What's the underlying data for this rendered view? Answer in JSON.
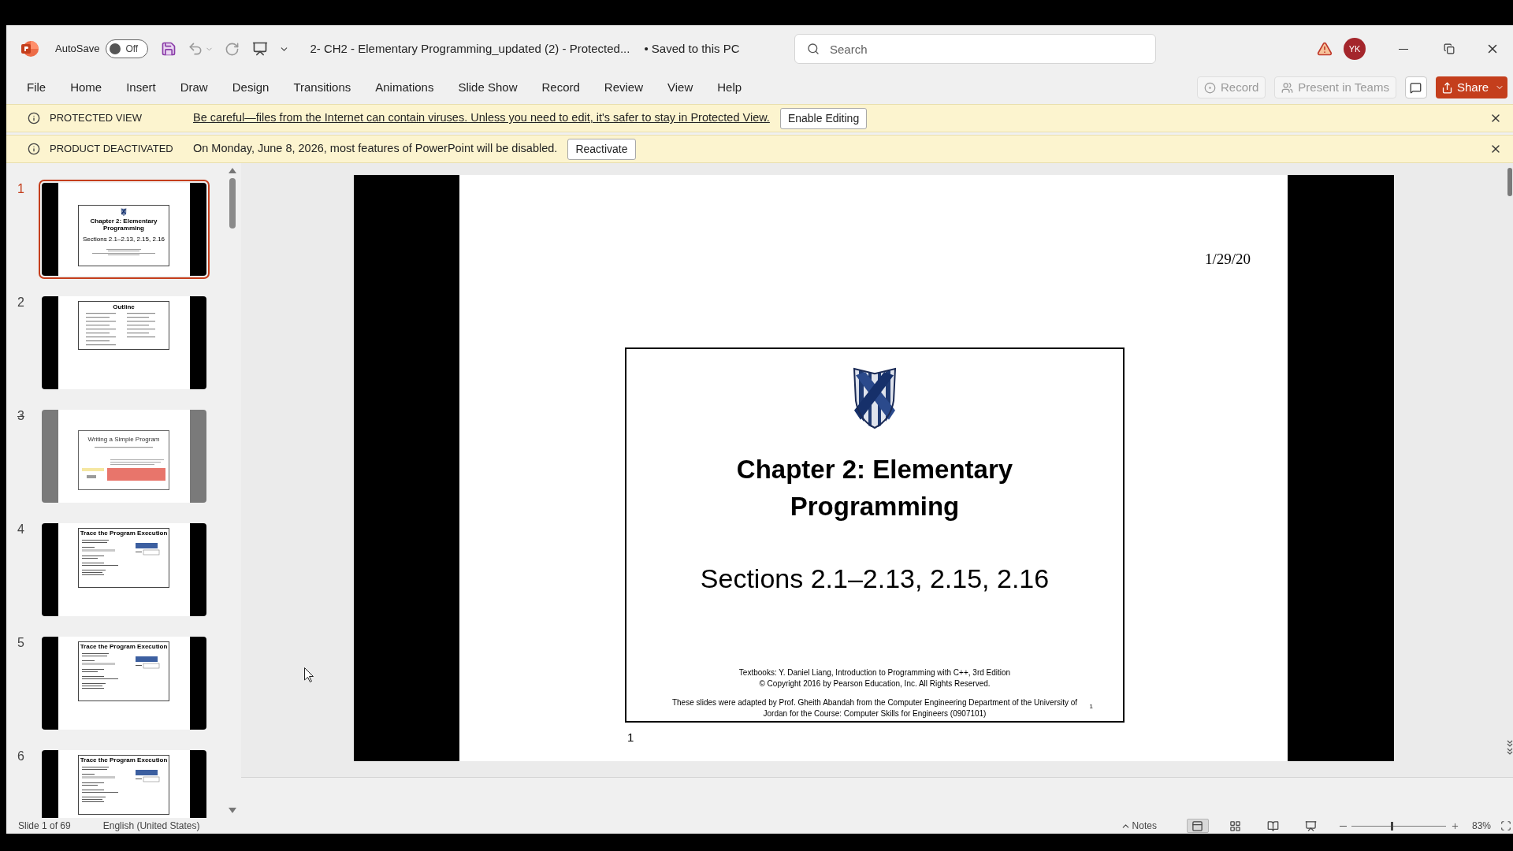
{
  "title_bar": {
    "autosave": {
      "label": "AutoSave",
      "on": false,
      "state_label": "Off"
    },
    "document_title": "2- CH2 - Elementary Programming_updated (2) - Protected...",
    "save_status": "• Saved to this PC",
    "search": {
      "placeholder": "Search"
    },
    "avatar": {
      "initials": "YK"
    }
  },
  "ribbon_tabs": [
    {
      "label": "File",
      "selected": false
    },
    {
      "label": "Home",
      "selected": false
    },
    {
      "label": "Insert",
      "selected": false
    },
    {
      "label": "Draw",
      "selected": false
    },
    {
      "label": "Design",
      "selected": false
    },
    {
      "label": "Transitions",
      "selected": false
    },
    {
      "label": "Animations",
      "selected": false
    },
    {
      "label": "Slide Show",
      "selected": false
    },
    {
      "label": "Record",
      "selected": false
    },
    {
      "label": "Review",
      "selected": false
    },
    {
      "label": "View",
      "selected": false
    },
    {
      "label": "Help",
      "selected": false
    }
  ],
  "ribbon_actions": [
    {
      "kind": "record",
      "label": "Record",
      "disabled": true
    },
    {
      "kind": "teams",
      "label": "Present in Teams",
      "disabled": true
    },
    {
      "kind": "comments"
    },
    {
      "kind": "share",
      "label": "Share"
    }
  ],
  "message_bars": [
    {
      "kind": "link",
      "title": "PROTECTED VIEW",
      "message": "Be careful—files from the Internet can contain viruses. Unless you need to edit, it's safer to stay in Protected View.",
      "button": "Enable Editing"
    },
    {
      "kind": "text",
      "title": "PRODUCT DEACTIVATED",
      "message": "On Monday, June 8, 2026, most features of PowerPoint will be disabled.",
      "button": "Reactivate"
    }
  ],
  "thumbnails": [
    {
      "number": "1",
      "selected": true,
      "hidden": false,
      "kind": "title",
      "title": "Chapter 2: Elementary Programming",
      "subtitle": "Sections 2.1–2.13, 2.15, 2.16"
    },
    {
      "number": "2",
      "selected": false,
      "hidden": false,
      "kind": "outline",
      "title": "Outline"
    },
    {
      "number": "3",
      "selected": false,
      "hidden": true,
      "kind": "text",
      "title": "Writing a Simple Program"
    },
    {
      "number": "4",
      "selected": false,
      "hidden": false,
      "kind": "code",
      "title": "Trace the Program Execution"
    },
    {
      "number": "5",
      "selected": false,
      "hidden": false,
      "kind": "code",
      "title": "Trace the Program Execution"
    },
    {
      "number": "6",
      "selected": false,
      "hidden": false,
      "kind": "code",
      "title": "Trace the Program Execution"
    }
  ],
  "slide": {
    "date": "1/29/20",
    "title": "Chapter 2: Elementary Programming",
    "subtitle": "Sections 2.1–2.13, 2.15, 2.16",
    "credits": [
      "Textbooks: Y. Daniel Liang, Introduction to Programming with C++, 3rd Edition",
      "© Copyright 2016 by Pearson Education, Inc. All Rights Reserved."
    ],
    "adaptation": "These slides were adapted by Prof. Gheith Abandah from the Computer Engineering Department of the University of Jordan for the Course: Computer Skills for Engineers (0907101)",
    "inner_number": "1",
    "page_number": "1"
  },
  "status_bar": {
    "slide_info": "Slide 1 of 69",
    "language": "English (United States)",
    "notes": "Notes",
    "views": [
      {
        "kind": "normal",
        "selected": true
      },
      {
        "kind": "sorter",
        "selected": false
      },
      {
        "kind": "reading",
        "selected": false
      },
      {
        "kind": "slideshow",
        "selected": false
      }
    ],
    "zoom": {
      "level": 0.42,
      "reading": "83%"
    }
  }
}
